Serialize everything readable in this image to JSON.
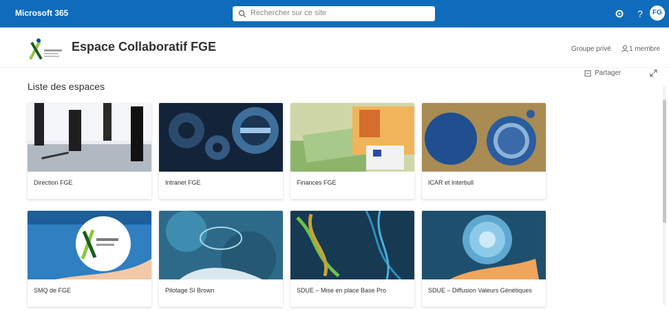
{
  "suitebar": {
    "app_title": "Microsoft 365",
    "search_placeholder": "Rechercher sur ce site",
    "avatar_initials": "FG",
    "help_glyph": "?"
  },
  "header": {
    "site_title": "Espace Collaboratif FGE",
    "group_type": "Groupe privé",
    "members": "1 membre"
  },
  "commands": {
    "share": "Partager",
    "section_title": "Liste des espaces"
  },
  "cards": [
    {
      "label": "Direction FGE"
    },
    {
      "label": "Intranet FGE"
    },
    {
      "label": "Finances FGE"
    },
    {
      "label": "ICAR et Interbull"
    },
    {
      "label": "SMQ de FGE"
    },
    {
      "label": "Pilotage SI Brown"
    },
    {
      "label": "SDUE – Mise en place Base Pro"
    },
    {
      "label": "SDUE – Diffusion Valeurs Génétiques"
    }
  ],
  "colors": {
    "suitebar": "#0f6cbd",
    "text": "#323130"
  }
}
